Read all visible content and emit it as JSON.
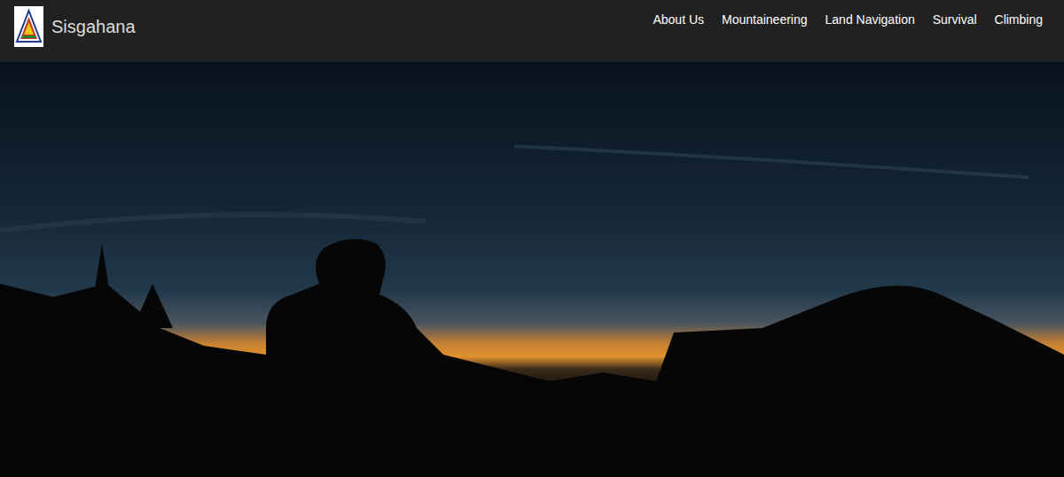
{
  "site": {
    "title": "Sisgahana"
  },
  "nav": [
    {
      "label": "About Us"
    },
    {
      "label": "Mountaineering"
    },
    {
      "label": "Land Navigation"
    },
    {
      "label": "Survival"
    },
    {
      "label": "Climbing"
    }
  ]
}
